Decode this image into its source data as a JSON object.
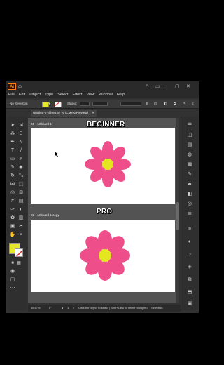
{
  "app": {
    "logo": "Ai",
    "menu": [
      "File",
      "Edit",
      "Object",
      "Type",
      "Select",
      "Effect",
      "View",
      "Window",
      "Help"
    ]
  },
  "control_bar": {
    "selection_label": "No Selection",
    "stroke_label": "Stroke:",
    "fill_color": "#e6e62c"
  },
  "document_tab": {
    "title": "Untitled-1* @ 66.67 % (CMYK/Preview)",
    "close": "✕"
  },
  "artboards": [
    {
      "label": "01 - Artboard 1",
      "overlay": "BEGINNER"
    },
    {
      "label": "02 - Artboard 1 copy",
      "overlay": "PRO"
    }
  ],
  "flower": {
    "petal_color": "#ee4f8a",
    "center_color": "#e4e620"
  },
  "status_bar": {
    "zoom": "66.67%",
    "rotation": "0°",
    "artboard_num": "1",
    "hint": "Click the object to select | Shift+Click to select multiple object | Alt+Drag the object to du",
    "mode": "Selection"
  },
  "icons": {
    "search": "search-icon",
    "home": "home-icon",
    "panels": "panels-icon"
  }
}
